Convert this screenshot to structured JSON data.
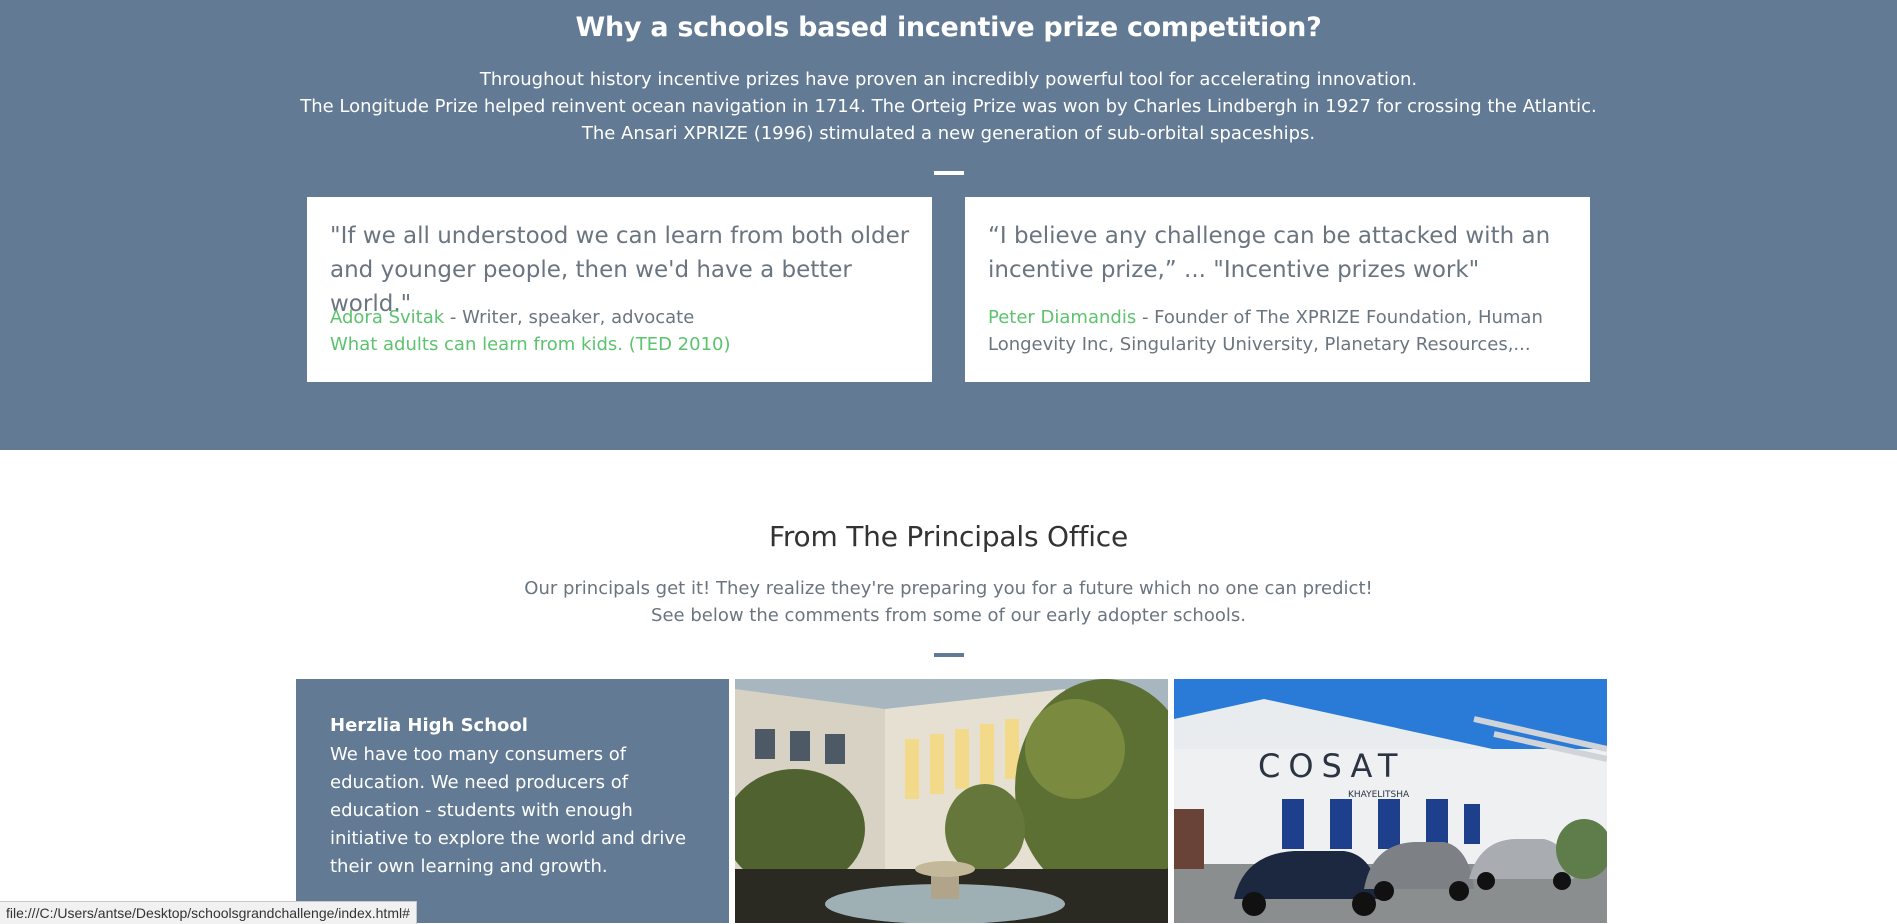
{
  "hero": {
    "title": "Why a schools based incentive prize competition?",
    "intro_line1": "Throughout history incentive prizes have proven an incredibly powerful tool for accelerating innovation.",
    "intro_line2": "The Longitude Prize helped reinvent ocean navigation in 1714. The Orteig Prize was won by Charles Lindbergh in 1927 for crossing the Atlantic. The Ansari XPRIZE (1996) stimulated a new generation of sub-orbital spaceships."
  },
  "quotes": [
    {
      "text": "\"If we all understood we can learn from both older and younger people, then we'd have a better world.\"",
      "author": "Adora Svitak",
      "role": " - Writer, speaker, advocate",
      "link": "What adults can learn from kids. (TED 2010)"
    },
    {
      "text": "“I believe any challenge can be attacked with an incentive prize,” ... \"Incentive prizes work\"",
      "author": "Peter Diamandis",
      "role": " - Founder of The XPRIZE Foundation, Human Longevity Inc, Singularity University, Planetary Resources,..."
    }
  ],
  "principals": {
    "title": "From The Principals Office",
    "sub_line1": "Our principals get it! They realize they're preparing you for a future which no one can predict!",
    "sub_line2": "See below the comments from some of our early adopter schools.",
    "school_name": "Herzlia High School",
    "school_quote": "We have too many consumers of education. We need producers of education - students with enough initiative to explore the world and drive their own learning and growth.",
    "image2_sign": "COSAT",
    "image2_sign_sub": "KHAYELITSHA"
  },
  "status_bar": {
    "url": "file:///C:/Users/antse/Desktop/schoolsgrandchallenge/index.html#"
  },
  "colors": {
    "section_bg": "#627a93",
    "accent_green": "#5cc36e",
    "text_gray": "#6a7580"
  }
}
